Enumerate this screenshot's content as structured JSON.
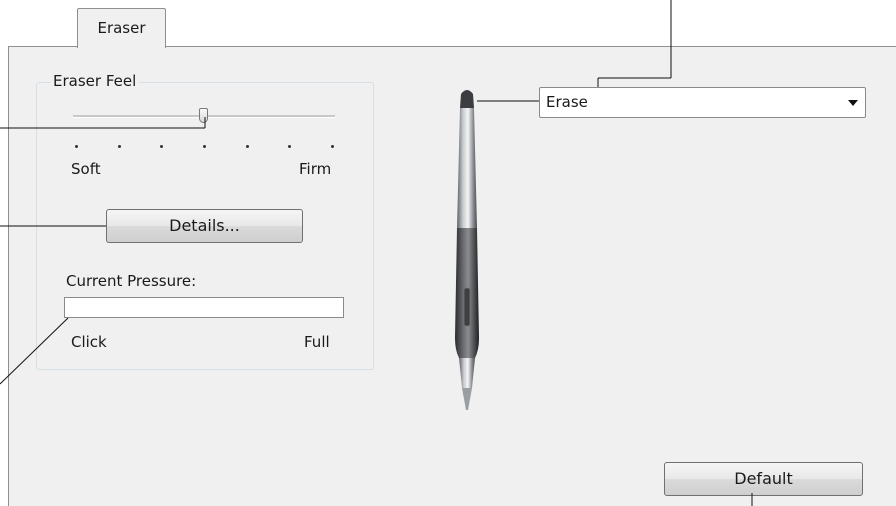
{
  "tab": {
    "label": "Eraser"
  },
  "eraser_feel": {
    "legend": "Eraser Feel",
    "soft_label": "Soft",
    "firm_label": "Firm",
    "slider_level": 0.5,
    "tick_count": 7
  },
  "details_button": {
    "label": "Details..."
  },
  "current_pressure": {
    "label": "Current Pressure:",
    "click_label": "Click",
    "full_label": "Full",
    "level": 0
  },
  "eraser_function": {
    "selected": "Erase"
  },
  "default_button": {
    "label": "Default"
  },
  "icons": {
    "pen": "pen-illustration-icon",
    "dropdown": "chevron-down-icon"
  }
}
